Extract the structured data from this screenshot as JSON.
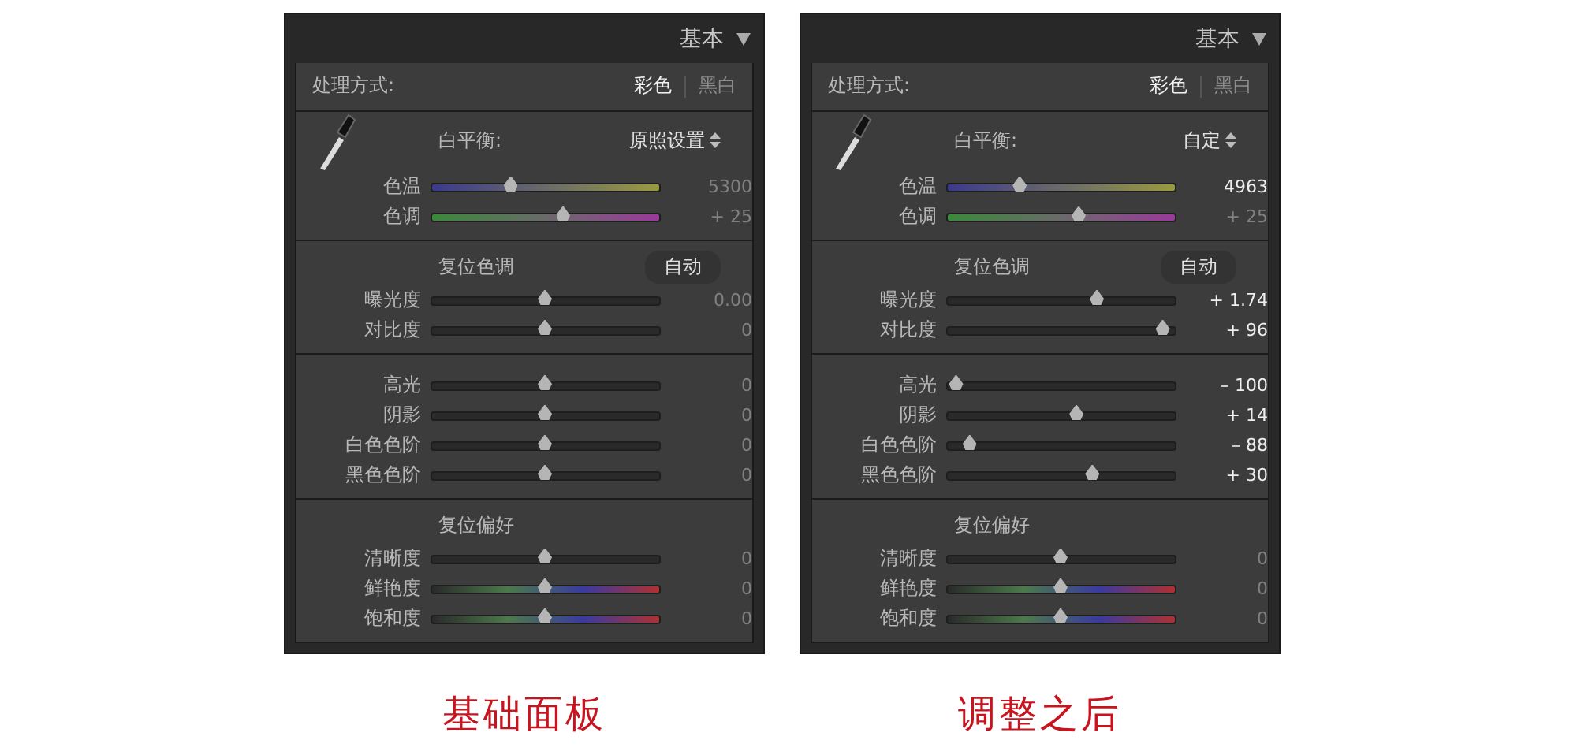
{
  "panels": [
    {
      "title": "基本",
      "caption": "基础面板",
      "treatment": {
        "label": "处理方式:",
        "options": [
          {
            "label": "彩色",
            "selected": true
          },
          {
            "label": "黑白",
            "selected": false
          }
        ]
      },
      "sections": [
        {
          "kind": "white_balance",
          "label": "白平衡:",
          "value": "原照设置",
          "sliders": [
            {
              "label": "色温",
              "kind": "temp",
              "level": 0.35,
              "reading": "5300",
              "modified": false
            },
            {
              "label": "色调",
              "kind": "tint",
              "level": 0.58,
              "reading": "+ 25",
              "modified": false
            }
          ]
        },
        {
          "kind": "group",
          "title": "复位色调",
          "button": "自动",
          "sliders": [
            {
              "label": "曝光度",
              "kind": "plain",
              "level": 0.5,
              "reading": "0.00",
              "modified": false
            },
            {
              "label": "对比度",
              "kind": "plain",
              "level": 0.5,
              "reading": "0",
              "modified": false
            }
          ]
        },
        {
          "kind": "plain",
          "sliders": [
            {
              "label": "高光",
              "kind": "plain",
              "level": 0.5,
              "reading": "0",
              "modified": false
            },
            {
              "label": "阴影",
              "kind": "plain",
              "level": 0.5,
              "reading": "0",
              "modified": false
            },
            {
              "label": "白色色阶",
              "kind": "plain",
              "level": 0.5,
              "reading": "0",
              "modified": false
            },
            {
              "label": "黑色色阶",
              "kind": "plain",
              "level": 0.5,
              "reading": "0",
              "modified": false
            }
          ]
        },
        {
          "kind": "group",
          "title": "复位偏好",
          "sliders": [
            {
              "label": "清晰度",
              "kind": "plain",
              "level": 0.5,
              "reading": "0",
              "modified": false
            },
            {
              "label": "鲜艳度",
              "kind": "vivid",
              "level": 0.5,
              "reading": "0",
              "modified": false
            },
            {
              "label": "饱和度",
              "kind": "vivid",
              "level": 0.5,
              "reading": "0",
              "modified": false
            }
          ]
        }
      ]
    },
    {
      "title": "基本",
      "caption": "调整之后",
      "treatment": {
        "label": "处理方式:",
        "options": [
          {
            "label": "彩色",
            "selected": true
          },
          {
            "label": "黑白",
            "selected": false
          }
        ]
      },
      "sections": [
        {
          "kind": "white_balance",
          "label": "白平衡:",
          "value": "自定",
          "sliders": [
            {
              "label": "色温",
              "kind": "temp",
              "level": 0.32,
              "reading": "4963",
              "modified": true
            },
            {
              "label": "色调",
              "kind": "tint",
              "level": 0.58,
              "reading": "+ 25",
              "modified": false
            }
          ]
        },
        {
          "kind": "group",
          "title": "复位色调",
          "button": "自动",
          "sliders": [
            {
              "label": "曝光度",
              "kind": "plain",
              "level": 0.66,
              "reading": "+ 1.74",
              "modified": true
            },
            {
              "label": "对比度",
              "kind": "plain",
              "level": 0.95,
              "reading": "+ 96",
              "modified": true
            }
          ]
        },
        {
          "kind": "plain",
          "sliders": [
            {
              "label": "高光",
              "kind": "plain",
              "level": 0.04,
              "reading": "– 100",
              "modified": true
            },
            {
              "label": "阴影",
              "kind": "plain",
              "level": 0.57,
              "reading": "+ 14",
              "modified": true
            },
            {
              "label": "白色色阶",
              "kind": "plain",
              "level": 0.1,
              "reading": "– 88",
              "modified": true
            },
            {
              "label": "黑色色阶",
              "kind": "plain",
              "level": 0.64,
              "reading": "+ 30",
              "modified": true
            }
          ]
        },
        {
          "kind": "group",
          "title": "复位偏好",
          "sliders": [
            {
              "label": "清晰度",
              "kind": "plain",
              "level": 0.5,
              "reading": "0",
              "modified": false
            },
            {
              "label": "鲜艳度",
              "kind": "vivid",
              "level": 0.5,
              "reading": "0",
              "modified": false
            },
            {
              "label": "饱和度",
              "kind": "vivid",
              "level": 0.5,
              "reading": "0",
              "modified": false
            }
          ]
        }
      ]
    }
  ]
}
